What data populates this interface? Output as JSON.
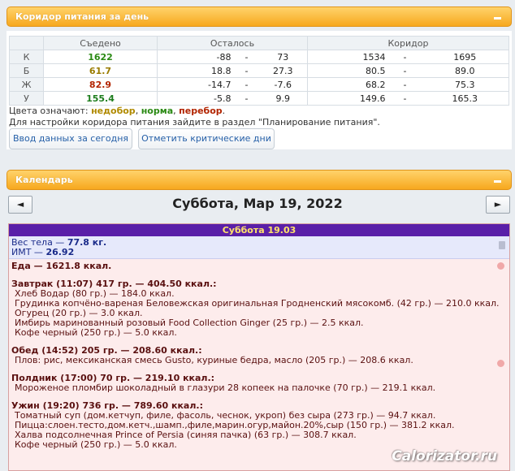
{
  "panel1": {
    "title": "Коридор питания за день"
  },
  "table": {
    "headers": [
      "Съедено",
      "Осталось",
      "Коридор"
    ],
    "rows": [
      {
        "label": "К",
        "eaten": "1622",
        "left_min": "-88",
        "left_max": "73",
        "corr_min": "1534",
        "corr_max": "1695"
      },
      {
        "label": "Б",
        "eaten": "61.7",
        "left_min": "18.8",
        "left_max": "27.3",
        "corr_min": "80.5",
        "corr_max": "89.0"
      },
      {
        "label": "Ж",
        "eaten": "82.9",
        "left_min": "-14.7",
        "left_max": "-7.6",
        "corr_min": "68.2",
        "corr_max": "75.3"
      },
      {
        "label": "У",
        "eaten": "155.4",
        "left_min": "-5.8",
        "left_max": "9.9",
        "corr_min": "149.6",
        "corr_max": "165.3"
      }
    ],
    "dash": "-"
  },
  "legend": {
    "prefix": "Цвета означают:",
    "under": "недобор",
    "norm": "норма",
    "over": "перебор",
    "comma": ",",
    "dot": ".",
    "hint": "Для настройки коридора питания зайдите в раздел \"Планирование питания\"."
  },
  "buttons": {
    "enter_today": "Ввод данных за сегодня",
    "mark_critical": "Отметить критические дни"
  },
  "panel2": {
    "title": "Календарь"
  },
  "calendar": {
    "prev": "◄",
    "next": "►",
    "date": "Суббота, Мар 19, 2022",
    "day_header": "Суббота 19.03"
  },
  "body": {
    "weight_label": "Вес тела — ",
    "weight_value": "77.8 кг.",
    "bmi_label": "ИМТ — ",
    "bmi_value": "26.92"
  },
  "food": {
    "total": "Еда — 1621.8 ккал.",
    "meals": [
      {
        "title": "Завтрак (11:07) 417 гр. — 404.50 ккал.:",
        "items": [
          "Хлеб Водар (80 гр.) — 184.0 ккал.",
          "Грудинка копчёно-вареная Беловежская оригинальная Гродненский мясокомб. (42 гр.) — 210.0 ккал.",
          "Огурец (20 гр.) — 3.0 ккал.",
          "Имбирь маринованный розовый Food Collection Ginger (25 гр.) — 2.5 ккал.",
          "Кофе черный (250 гр.) — 5.0 ккал."
        ]
      },
      {
        "title": "Обед (14:52) 205 гр. — 208.60 ккал.:",
        "items": [
          "Плов: рис, мексиканская смесь Gusto, куриные бедра, масло (205 гр.) — 208.6 ккал."
        ]
      },
      {
        "title": "Полдник (17:00) 70 гр. — 219.10 ккал.:",
        "items": [
          "Мороженое пломбир шоколадный в глазури 28 копеек на палочке (70 гр.) — 219.1 ккал."
        ]
      },
      {
        "title": "Ужин (19:20) 736 гр. — 789.60 ккал.:",
        "items": [
          "Томатный суп (дом.кетчуп, филе, фасоль, чеснок, укроп) без сыра (273 гр.) — 94.7 ккал.",
          "Пицца:слоен.тесто,дом.кетч.,шамп.,филе,марин.огур,майон.20%,сыр (150 гр.) — 381.2 ккал.",
          "Халва подсолнечная Prince of Persia (синяя пачка) (63 гр.) — 308.7 ккал.",
          "Кофе черный (250 гр.) — 5.0 ккал."
        ]
      }
    ]
  },
  "watermark": "Calorizator.ru"
}
